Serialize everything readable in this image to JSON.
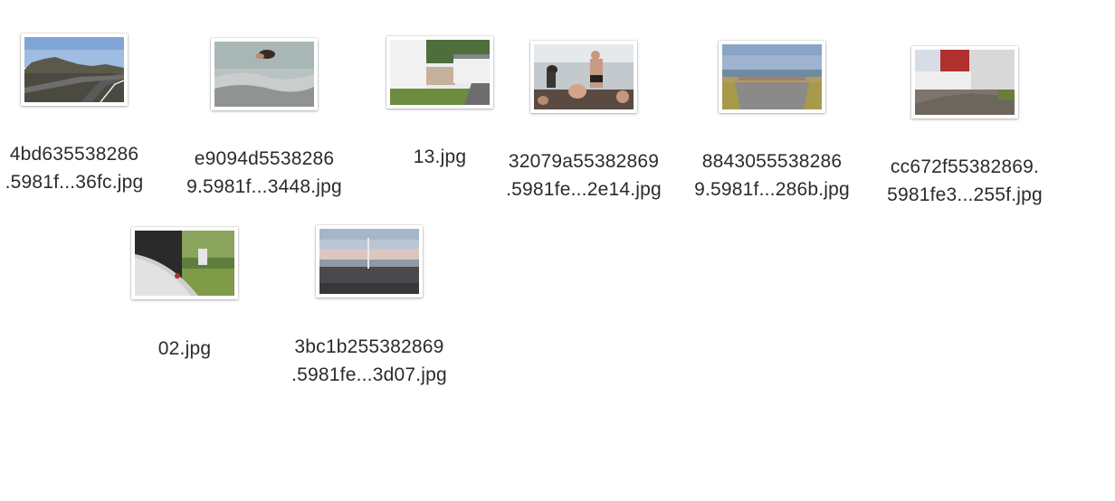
{
  "files": [
    {
      "id": "f1",
      "thumb": "volcanic-road-photo",
      "line1": "4bd635538286",
      "line2": ".5981f...36fc.jpg"
    },
    {
      "id": "f2",
      "thumb": "swimmer-in-water-photo",
      "line1": "e9094d5538286",
      "line2": "9.5981f...3448.jpg"
    },
    {
      "id": "f3",
      "thumb": "white-house-yard-photo",
      "line1": "13.jpg",
      "line2": ""
    },
    {
      "id": "f4",
      "thumb": "people-bathing-photo",
      "line1": "32079a55382869",
      "line2": ".5981fe...2e14.jpg"
    },
    {
      "id": "f5",
      "thumb": "seaside-promenade-photo",
      "line1": "8843055538286",
      "line2": "9.5981f...286b.jpg"
    },
    {
      "id": "f6",
      "thumb": "red-building-photo",
      "line1": "cc672f55382869.",
      "line2": "5981fe3...255f.jpg"
    },
    {
      "id": "f7",
      "thumb": "bathtub-garden-photo",
      "line1": "02.jpg",
      "line2": ""
    },
    {
      "id": "f8",
      "thumb": "beach-dusk-photo",
      "line1": "3bc1b255382869",
      "line2": ".5981fe...3d07.jpg"
    }
  ]
}
